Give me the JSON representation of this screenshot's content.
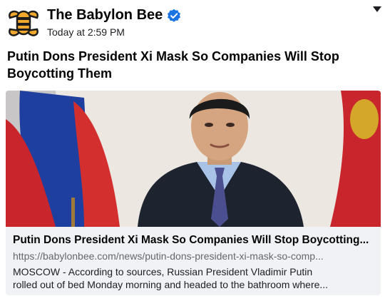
{
  "post": {
    "page_name": "The Babylon Bee",
    "timestamp": "Today at 2:59 PM",
    "text": "Putin Dons President Xi Mask So Companies Will Stop Boycotting Them",
    "avatar_icon": "bee-logo-icon",
    "verified_icon": "verified-badge-icon",
    "menu_icon": "caret-down-icon"
  },
  "link_card": {
    "title": "Putin Dons President Xi Mask So Companies Will Stop Boycotting...",
    "url": "https://babylonbee.com/news/putin-dons-president-xi-mask-so-comp...",
    "description_line1": "MOSCOW - According to sources, Russian President Vladimir Putin",
    "description_line2": "rolled out of bed Monday morning and headed to the bathroom where..."
  },
  "colors": {
    "brand_blue": "#1b74e4",
    "bee_orange": "#f1a82c",
    "card_bg": "#f0f2f5"
  }
}
